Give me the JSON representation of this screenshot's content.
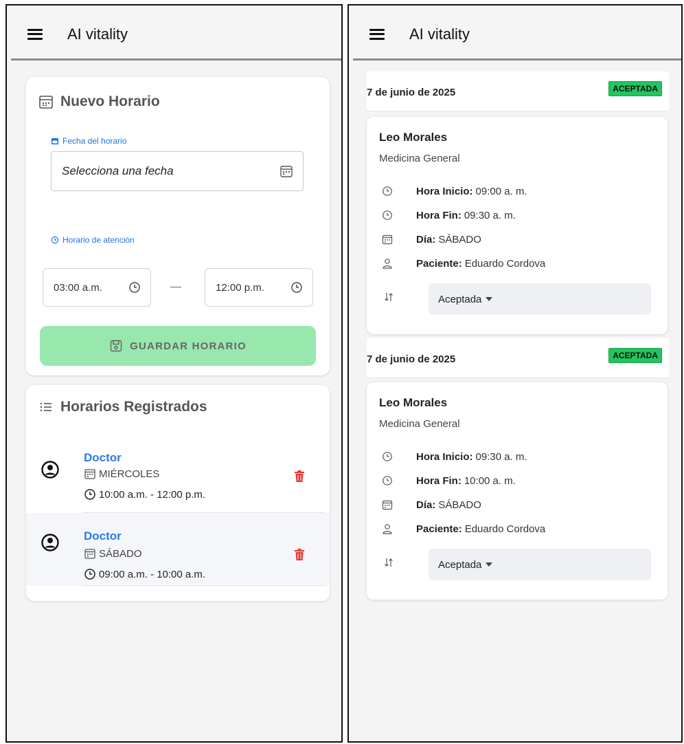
{
  "left": {
    "app_title": "AI vitality",
    "new_schedule": {
      "title": "Nuevo Horario",
      "date_label": "Fecha del horario",
      "date_placeholder": "Selecciona una fecha",
      "hours_label": "Horario de atención",
      "start_time": "03:00 a.m.",
      "end_time": "12:00 p.m.",
      "save_label": "GUARDAR HORARIO"
    },
    "registered": {
      "title": "Horarios Registrados",
      "items": [
        {
          "name": "Doctor",
          "day": "MIÉRCOLES",
          "time": "10:00 a.m. - 12:00 p.m."
        },
        {
          "name": "Doctor",
          "day": "SÁBADO",
          "time": "09:00 a.m. - 10:00 a.m."
        }
      ]
    }
  },
  "right": {
    "app_title": "AI vitality",
    "appointments": [
      {
        "date": "7 de junio de 2025",
        "badge": "ACEPTADA",
        "doctor": "Leo Morales",
        "specialty": "Medicina General",
        "start_label": "Hora Inicio:",
        "start": "09:00 a. m.",
        "end_label": "Hora Fin:",
        "end": "09:30 a. m.",
        "day_label": "Día:",
        "day": "SÁBADO",
        "patient_label": "Paciente:",
        "patient": "Eduardo Cordova",
        "status": "Aceptada"
      },
      {
        "date": "7 de junio de 2025",
        "badge": "ACEPTADA",
        "doctor": "Leo Morales",
        "specialty": "Medicina General",
        "start_label": "Hora Inicio:",
        "start": "09:30 a. m.",
        "end_label": "Hora Fin:",
        "end": "10:00 a. m.",
        "day_label": "Día:",
        "day": "SÁBADO",
        "patient_label": "Paciente:",
        "patient": "Eduardo Cordova",
        "status": "Aceptada"
      }
    ]
  },
  "colors": {
    "link_blue": "#1a73e8",
    "doctor_blue": "#2a7be6",
    "save_button_green": "#98e8ad",
    "badge_green": "#22c55e",
    "trash_red": "#e53935"
  }
}
